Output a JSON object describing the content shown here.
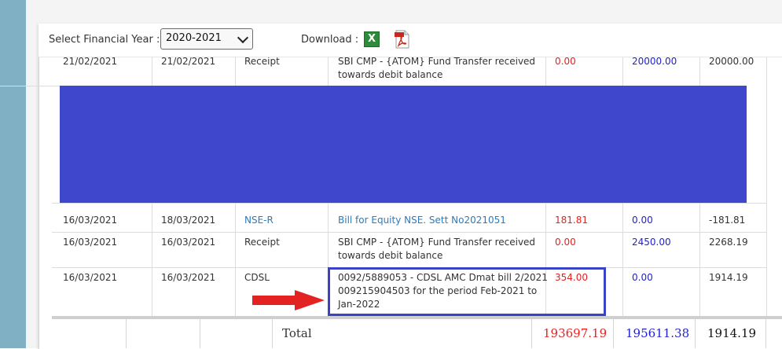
{
  "toolbar": {
    "fy_label": "Select Financial Year :",
    "fy_value": "2020-2021",
    "download_label": "Download :",
    "xls_glyph": "X"
  },
  "icons": [
    "excel-icon",
    "pdf-icon"
  ],
  "rows": [
    {
      "date1": "21/02/2021",
      "date2": "21/02/2021",
      "type": "Receipt",
      "desc1": "SBI CMP - {ATOM} Fund Transfer received",
      "desc2": "towards debit balance",
      "debit": "0.00",
      "credit": "20000.00",
      "balance": "20000.00"
    },
    {
      "date1": "16/03/2021",
      "date2": "18/03/2021",
      "type": "NSE-R",
      "desc1": "Bill for Equity NSE. Sett No2021051",
      "desc2": "",
      "debit": "181.81",
      "credit": "0.00",
      "balance": "-181.81"
    },
    {
      "date1": "16/03/2021",
      "date2": "16/03/2021",
      "type": "Receipt",
      "desc1": "SBI CMP - {ATOM} Fund Transfer received",
      "desc2": "towards debit balance",
      "debit": "0.00",
      "credit": "2450.00",
      "balance": "2268.19"
    },
    {
      "date1": "16/03/2021",
      "date2": "16/03/2021",
      "type": "CDSL",
      "desc1": "0092/5889053 - CDSL AMC Dmat bill 2/2021",
      "desc2": "009215904503 for the period Feb-2021 to",
      "desc3": "Jan-2022",
      "debit": "354.00",
      "credit": "0.00",
      "balance": "1914.19"
    }
  ],
  "totals": {
    "label": "Total",
    "debit": "193697.19",
    "credit": "195611.38",
    "balance": "1914.19"
  },
  "colors": {
    "debit": "#e32222",
    "credit": "#2222cc",
    "link": "#2a7bbf",
    "redaction": "#3f47cc",
    "highlight_box": "#3a42c8",
    "arrow": "#e32222",
    "sidebar": "#7fb0c4"
  }
}
